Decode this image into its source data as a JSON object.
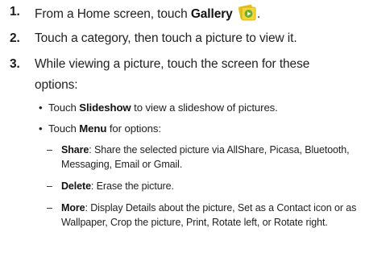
{
  "steps": [
    {
      "number": "1.",
      "pre": "From a Home screen, touch ",
      "bold": "Gallery",
      "icon": "gallery-icon",
      "post": "."
    },
    {
      "number": "2.",
      "text": "Touch a category, then touch a picture to view it."
    },
    {
      "number": "3.",
      "line1": "While viewing a picture, touch the screen for these",
      "line2": "options:"
    }
  ],
  "bullets": [
    {
      "pre": "Touch ",
      "bold": "Slideshow",
      "post": "  to view a slideshow of pictures."
    },
    {
      "pre": "Touch ",
      "bold": "Menu",
      "post": "  for options:"
    }
  ],
  "sub_items": [
    {
      "bold": "Share",
      "line1": ": Share the selected picture via AllShare, Picasa, Bluetooth,",
      "line2": "Messaging, Email or Gmail."
    },
    {
      "bold": "Delete",
      "line1": ": Erase the picture."
    },
    {
      "bold": "More",
      "line1": ": Display Details about the picture, Set as a Contact icon or as",
      "line2": "Wallpaper, Crop the picture, Print, Rotate left, or Rotate right."
    }
  ],
  "bullet_glyph": "•",
  "dash_glyph": "–",
  "colors": {
    "icon_yellow": "#e8c21a",
    "icon_green": "#6cae2e"
  }
}
